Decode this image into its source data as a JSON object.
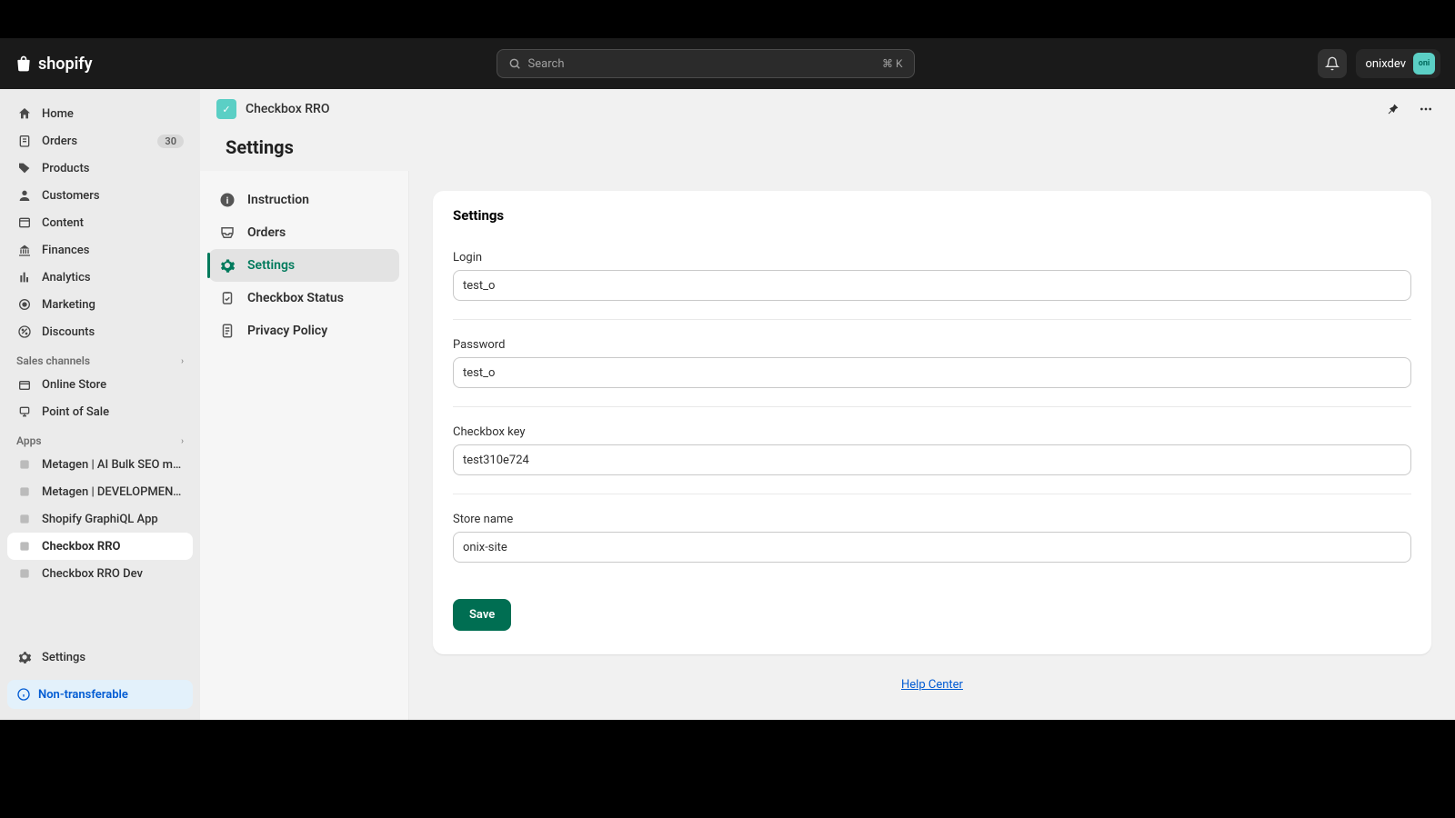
{
  "brand": "shopify",
  "search": {
    "placeholder": "Search",
    "kbd": "⌘ K"
  },
  "user": {
    "name": "onixdev",
    "avatar_text": "oni"
  },
  "sidebar": {
    "items": [
      {
        "label": "Home",
        "name": "home"
      },
      {
        "label": "Orders",
        "name": "orders",
        "badge": "30"
      },
      {
        "label": "Products",
        "name": "products"
      },
      {
        "label": "Customers",
        "name": "customers"
      },
      {
        "label": "Content",
        "name": "content"
      },
      {
        "label": "Finances",
        "name": "finances"
      },
      {
        "label": "Analytics",
        "name": "analytics"
      },
      {
        "label": "Marketing",
        "name": "marketing"
      },
      {
        "label": "Discounts",
        "name": "discounts"
      }
    ],
    "sales_section": "Sales channels",
    "sales": [
      {
        "label": "Online Store",
        "name": "online-store"
      },
      {
        "label": "Point of Sale",
        "name": "point-of-sale"
      }
    ],
    "apps_section": "Apps",
    "apps": [
      {
        "label": "Metagen | AI Bulk SEO me...",
        "name": "metagen-seo"
      },
      {
        "label": "Metagen | DEVELOPMENT...",
        "name": "metagen-dev"
      },
      {
        "label": "Shopify GraphiQL App",
        "name": "graphiql"
      },
      {
        "label": "Checkbox RRO",
        "name": "checkbox-rro",
        "active": true
      },
      {
        "label": "Checkbox RRO Dev",
        "name": "checkbox-rro-dev"
      }
    ],
    "settings": "Settings",
    "non_transferable": "Non-transferable"
  },
  "app_header": {
    "name": "Checkbox RRO"
  },
  "page_title": "Settings",
  "settings_nav": [
    {
      "label": "Instruction",
      "name": "instruction"
    },
    {
      "label": "Orders",
      "name": "orders"
    },
    {
      "label": "Settings",
      "name": "settings",
      "active": true
    },
    {
      "label": "Checkbox Status",
      "name": "checkbox-status"
    },
    {
      "label": "Privacy Policy",
      "name": "privacy-policy"
    }
  ],
  "card": {
    "title": "Settings",
    "fields": {
      "login": {
        "label": "Login",
        "value": "test_o"
      },
      "password": {
        "label": "Password",
        "value": "test_o"
      },
      "checkbox_key": {
        "label": "Checkbox key",
        "value": "test310e724"
      },
      "store_name": {
        "label": "Store name",
        "value": "onix-site"
      }
    },
    "save": "Save"
  },
  "help_center": "Help Center"
}
